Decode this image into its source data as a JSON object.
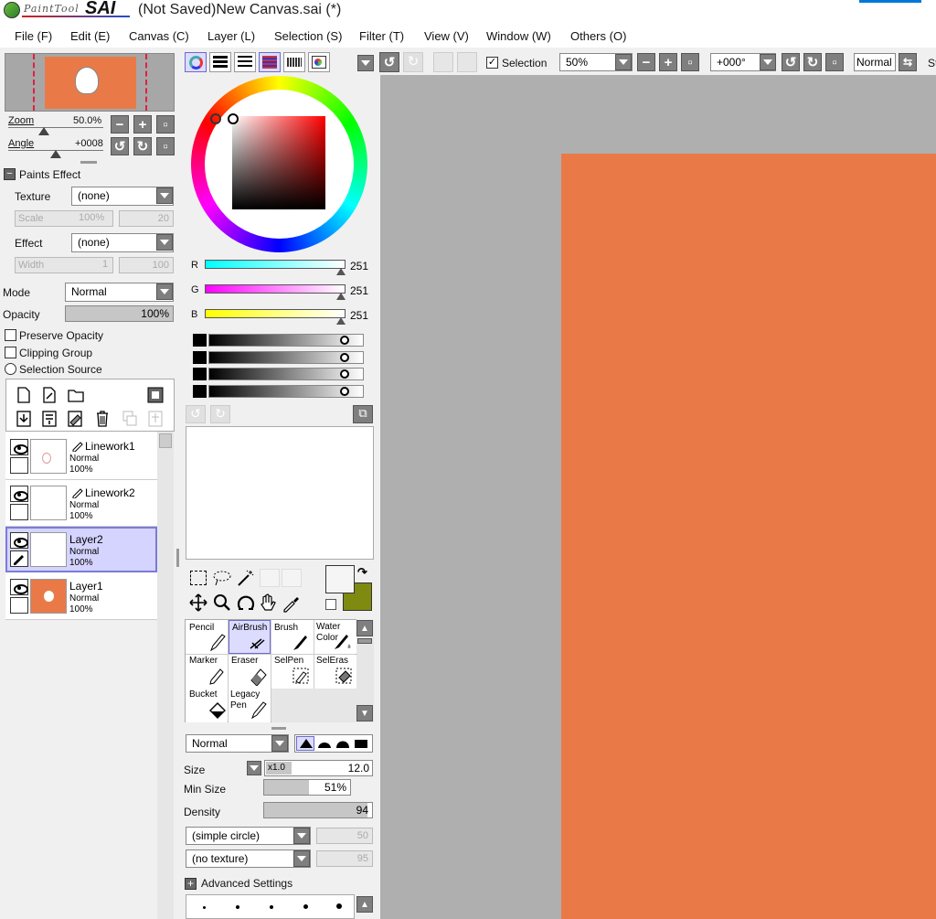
{
  "titlebar": {
    "logo_small": "PaintTool",
    "logo_big": "SAI",
    "title": "(Not Saved)New Canvas.sai (*)"
  },
  "menu": [
    "File (F)",
    "Edit (E)",
    "Canvas (C)",
    "Layer (L)",
    "Selection (S)",
    "Filter (T)",
    "View (V)",
    "Window (W)",
    "Others (O)"
  ],
  "navigator": {
    "zoom_label": "Zoom",
    "zoom_value": "50.0%",
    "angle_label": "Angle",
    "angle_value": "+0008"
  },
  "paints_effect": {
    "header": "Paints Effect",
    "texture_label": "Texture",
    "texture_value": "(none)",
    "scale_label": "Scale",
    "scale_value": "100%",
    "scale_num": "20",
    "effect_label": "Effect",
    "effect_value": "(none)",
    "width_label": "Width",
    "width_value": "1",
    "width_num": "100"
  },
  "layer_props": {
    "mode_label": "Mode",
    "mode_value": "Normal",
    "opacity_label": "Opacity",
    "opacity_value": "100%",
    "preserve_opacity": "Preserve Opacity",
    "clipping_group": "Clipping Group",
    "selection_source": "Selection Source"
  },
  "layers": [
    {
      "name": "Linework1",
      "mode": "Normal",
      "opacity": "100%",
      "selected": false,
      "thumb_color": "#ffffff"
    },
    {
      "name": "Linework2",
      "mode": "Normal",
      "opacity": "100%",
      "selected": false,
      "thumb_color": "#ffffff"
    },
    {
      "name": "Layer2",
      "mode": "Normal",
      "opacity": "100%",
      "selected": true,
      "thumb_color": "#ffffff"
    },
    {
      "name": "Layer1",
      "mode": "Normal",
      "opacity": "100%",
      "selected": false,
      "thumb_color": "#e97a48"
    }
  ],
  "color": {
    "r_label": "R",
    "r_value": "251",
    "g_label": "G",
    "g_value": "251",
    "b_label": "B",
    "b_value": "251",
    "primary": "#f5f5f5",
    "secondary": "#7f8a10"
  },
  "tools": [
    {
      "name": "Pencil",
      "selected": false
    },
    {
      "name": "AirBrush",
      "selected": true
    },
    {
      "name": "Brush",
      "selected": false
    },
    {
      "name": "Water Color",
      "selected": false
    },
    {
      "name": "Marker",
      "selected": false
    },
    {
      "name": "Eraser",
      "selected": false
    },
    {
      "name": "SelPen",
      "selected": false
    },
    {
      "name": "SelEras",
      "selected": false
    },
    {
      "name": "Bucket",
      "selected": false
    },
    {
      "name": "Legacy Pen",
      "selected": false
    }
  ],
  "brush": {
    "mode_value": "Normal",
    "size_label": "Size",
    "size_mult": "x1.0",
    "size_value": "12.0",
    "minsize_label": "Min Size",
    "minsize_value": "51%",
    "density_label": "Density",
    "density_value": "94",
    "shape_value": "(simple circle)",
    "shape_num": "50",
    "texture_value": "(no texture)",
    "texture_num": "95",
    "advanced_label": "Advanced Settings"
  },
  "toolbar": {
    "selection_label": "Selection",
    "zoom_value": "50%",
    "angle_value": "+000°",
    "blend_value": "Normal",
    "stab_label": "St"
  },
  "canvas_color": "#e97a48"
}
